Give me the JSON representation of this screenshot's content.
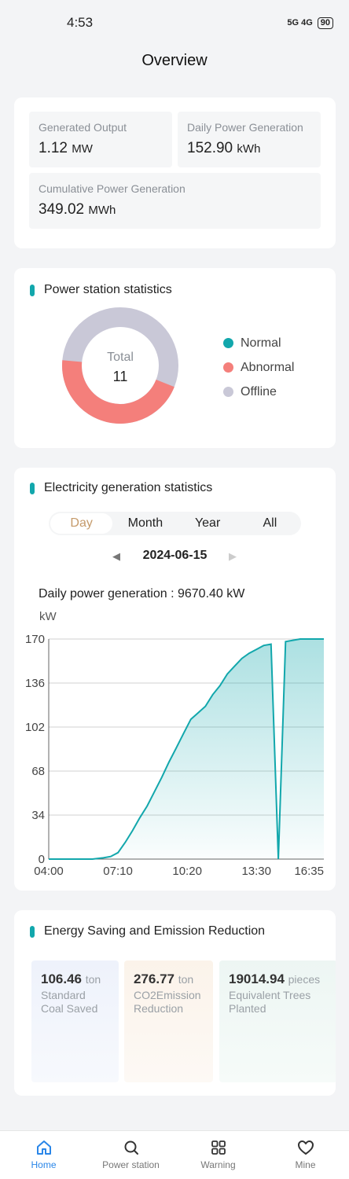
{
  "status": {
    "time": "4:53",
    "signal_text": "5G 4G",
    "battery": "90"
  },
  "header": {
    "title": "Overview"
  },
  "summary": {
    "generated_output": {
      "label": "Generated Output",
      "value": "1.12",
      "unit": "MW"
    },
    "daily_generation": {
      "label": "Daily Power Generation",
      "value": "152.90",
      "unit": "kWh"
    },
    "cumulative_generation": {
      "label": "Cumulative Power Generation",
      "value": "349.02",
      "unit": "MWh"
    }
  },
  "station_stats": {
    "title": "Power station statistics",
    "total_label": "Total",
    "total_value": "11",
    "legend": [
      {
        "label": "Normal",
        "color": "#12a7ac",
        "value": 0
      },
      {
        "label": "Abnormal",
        "color": "#f47f7b",
        "value": 5
      },
      {
        "label": "Offline",
        "color": "#c9c8d7",
        "value": 6
      }
    ]
  },
  "generation_stats": {
    "title": "Electricity generation statistics",
    "tabs": [
      "Day",
      "Month",
      "Year",
      "All"
    ],
    "active_tab": "Day",
    "date": "2024-06-15",
    "daily_label": "Daily power generation : 9670.40 kW",
    "unit_label": "kW"
  },
  "chart_data": {
    "type": "area",
    "ylabel": "kW",
    "ylim": [
      0,
      170
    ],
    "yticks": [
      "0",
      "34",
      "68",
      "102",
      "136",
      "170"
    ],
    "xticks": [
      "04:00",
      "07:10",
      "10:20",
      "13:30",
      "16:35"
    ],
    "x_minutes": [
      240,
      300,
      360,
      390,
      410,
      430,
      450,
      470,
      490,
      510,
      530,
      550,
      570,
      590,
      610,
      630,
      650,
      670,
      690,
      710,
      730,
      750,
      770,
      790,
      810,
      830,
      850,
      870,
      890,
      910,
      930,
      950,
      970,
      985,
      986,
      990,
      995
    ],
    "values": [
      0,
      0,
      0,
      1,
      2,
      5,
      13,
      22,
      32,
      41,
      52,
      63,
      75,
      86,
      97,
      108,
      113,
      118,
      127,
      134,
      143,
      149,
      155,
      159,
      162,
      165,
      166,
      0,
      168,
      169,
      170,
      170,
      170,
      170,
      170,
      170,
      170
    ],
    "series_color": "#12a7ac",
    "grid": true
  },
  "energy": {
    "title": "Energy Saving and Emission Reduction",
    "items": [
      {
        "value": "106.46",
        "unit": "ton",
        "label_line1": "Standard",
        "label_line2": "Coal Saved"
      },
      {
        "value": "276.77",
        "unit": "ton",
        "label_line1": "CO2Emission",
        "label_line2": "Reduction"
      },
      {
        "value": "19014.94",
        "unit": "pieces",
        "label_line1": "Equivalent Trees",
        "label_line2": "Planted"
      }
    ]
  },
  "tabbar": {
    "items": [
      {
        "label": "Home",
        "icon": "home-icon"
      },
      {
        "label": "Power station",
        "icon": "search-icon"
      },
      {
        "label": "Warning",
        "icon": "grid-icon"
      },
      {
        "label": "Mine",
        "icon": "heart-icon"
      }
    ]
  }
}
